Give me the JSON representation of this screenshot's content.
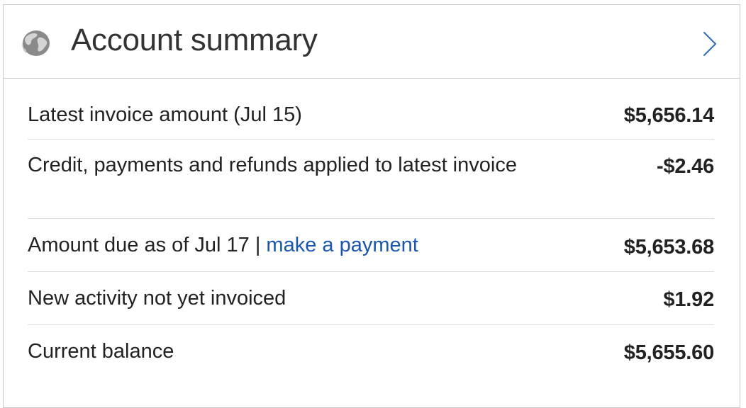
{
  "header": {
    "title": "Account summary",
    "globe_icon": "globe-icon",
    "chevron_icon": "chevron-right-icon"
  },
  "rows": {
    "latest_invoice": {
      "label": "Latest invoice amount (Jul 15)",
      "value": "$5,656.14"
    },
    "credits": {
      "label": "Credit, payments and refunds applied to latest invoice",
      "value": "-$2.46"
    },
    "amount_due": {
      "label": "Amount due as of Jul 17",
      "separator": " | ",
      "link": "make a payment",
      "value": "$5,653.68"
    },
    "new_activity": {
      "label": "New activity not yet invoiced",
      "value": "$1.92"
    },
    "current_balance": {
      "label": "Current balance",
      "value": "$5,655.60"
    }
  },
  "colors": {
    "link": "#1a56b0",
    "border": "#c9c9c9",
    "divider": "#dddddd",
    "text": "#222222",
    "icon": "#8a8a8a",
    "chevron": "#3b6fb6"
  }
}
